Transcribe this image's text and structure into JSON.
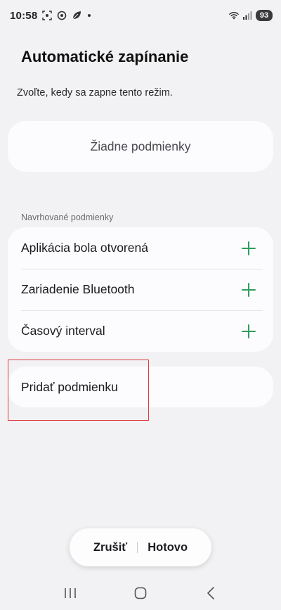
{
  "status_bar": {
    "time": "10:58",
    "battery": "93",
    "icons": [
      "screenshot-icon",
      "smart-icon",
      "leaf-icon",
      "dot-icon",
      "wifi-icon",
      "signal-icon",
      "battery-icon"
    ]
  },
  "header": {
    "title": "Automatické zapínanie",
    "subtitle": "Zvoľte, kedy sa zapne tento režim."
  },
  "current_conditions": {
    "empty_label": "Žiadne podmienky"
  },
  "suggested": {
    "header": "Navrhované podmienky",
    "items": [
      {
        "label": "Aplikácia bola otvorená",
        "icon": "plus-icon"
      },
      {
        "label": "Zariadenie Bluetooth",
        "icon": "plus-icon"
      },
      {
        "label": "Časový interval",
        "icon": "plus-icon"
      }
    ]
  },
  "add_condition": {
    "label": "Pridať podmienku"
  },
  "actions": {
    "cancel": "Zrušiť",
    "done": "Hotovo"
  },
  "colors": {
    "accent_plus": "#2e9e5e",
    "highlight": "#e0393e",
    "background": "#f2f2f4",
    "card": "#fcfcfe"
  }
}
